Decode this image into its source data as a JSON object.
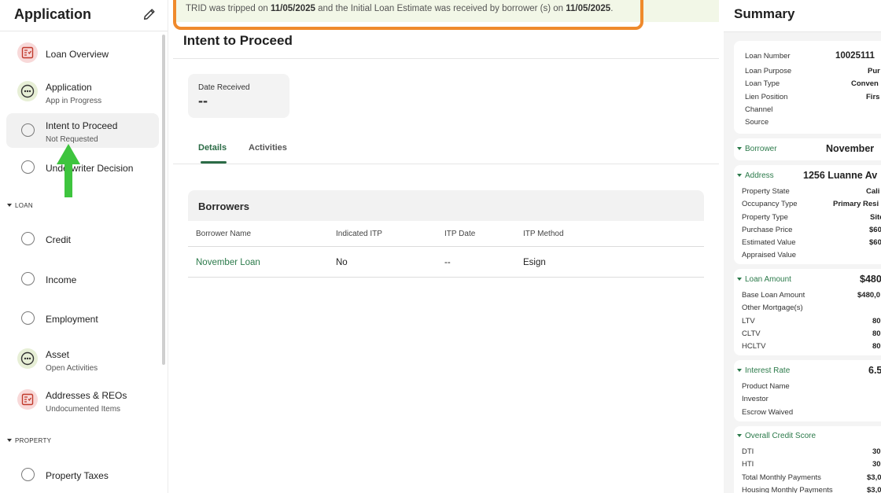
{
  "sidebar": {
    "title": "Application",
    "items": [
      {
        "label": "Loan Overview",
        "sub": "",
        "icon": "document-check-icon"
      },
      {
        "label": "Application",
        "sub": "App in Progress",
        "icon": "in-progress-icon"
      },
      {
        "label": "Intent to Proceed",
        "sub": "Not Requested",
        "icon": "empty-circle-icon"
      },
      {
        "label": "Underwriter Decision",
        "sub": "",
        "icon": "empty-circle-icon"
      }
    ],
    "section_loan": "LOAN",
    "loan_items": [
      {
        "label": "Credit",
        "sub": ""
      },
      {
        "label": "Income",
        "sub": ""
      },
      {
        "label": "Employment",
        "sub": ""
      },
      {
        "label": "Asset",
        "sub": "Open Activities"
      },
      {
        "label": "Addresses & REOs",
        "sub": "Undocumented Items"
      }
    ],
    "section_property": "PROPERTY",
    "property_items": [
      {
        "label": "Property Taxes",
        "sub": ""
      }
    ]
  },
  "banner": {
    "text_1": "TRID was tripped on ",
    "date_1": "11/05/2025",
    "text_2": " and the Initial Loan Estimate was received by borrower (s) on ",
    "date_2": "11/05/2025",
    "text_3": "."
  },
  "main": {
    "title": "Intent to Proceed",
    "date_label": "Date Received",
    "date_value": "--",
    "tabs": [
      "Details",
      "Activities"
    ],
    "borrowers": {
      "title": "Borrowers",
      "columns": [
        "Borrower Name",
        "Indicated ITP",
        "ITP Date",
        "ITP Method"
      ],
      "rows": [
        {
          "name": "November Loan",
          "indicated": "No",
          "date": "--",
          "method": "Esign"
        }
      ]
    }
  },
  "summary": {
    "title": "Summary",
    "loan": [
      {
        "label": "Loan Number",
        "value": "10025111"
      },
      {
        "label": "Loan Purpose",
        "value": "Pur"
      },
      {
        "label": "Loan Type",
        "value": "Conven"
      },
      {
        "label": "Lien Position",
        "value": "Firs"
      },
      {
        "label": "Channel",
        "value": ""
      },
      {
        "label": "Source",
        "value": ""
      }
    ],
    "borrower": {
      "label": "Borrower",
      "value": "November"
    },
    "address": {
      "label": "Address",
      "value": "1256 Luanne Av"
    },
    "address_rows": [
      {
        "label": "Property State",
        "value": "Cali"
      },
      {
        "label": "Occupancy Type",
        "value": "Primary Resi"
      },
      {
        "label": "Property Type",
        "value": "Site"
      },
      {
        "label": "Purchase Price",
        "value": "$60"
      },
      {
        "label": "Estimated Value",
        "value": "$60"
      },
      {
        "label": "Appraised Value",
        "value": ""
      }
    ],
    "loan_amount": {
      "label": "Loan Amount",
      "value": "$480"
    },
    "loan_amount_rows": [
      {
        "label": "Base Loan Amount",
        "value": "$480,0"
      },
      {
        "label": "Other Mortgage(s)",
        "value": ""
      },
      {
        "label": "LTV",
        "value": "80"
      },
      {
        "label": "CLTV",
        "value": "80"
      },
      {
        "label": "HCLTV",
        "value": "80"
      }
    ],
    "interest_rate": {
      "label": "Interest Rate",
      "value": "6.5"
    },
    "interest_rows": [
      {
        "label": "Product Name",
        "value": ""
      },
      {
        "label": "Investor",
        "value": ""
      },
      {
        "label": "Escrow Waived",
        "value": ""
      }
    ],
    "credit_score": {
      "label": "Overall Credit Score",
      "value": ""
    },
    "credit_rows": [
      {
        "label": "DTI",
        "value": "30"
      },
      {
        "label": "HTI",
        "value": "30"
      },
      {
        "label": "Total Monthly Payments",
        "value": "$3,0"
      },
      {
        "label": "Housing Monthly Payments",
        "value": "$3,0"
      }
    ]
  },
  "colors": {
    "accent_green": "#2b6b46",
    "banner_border": "#ef8a2c",
    "banner_bg": "#f2f7e7",
    "arrow": "#3ec43e"
  }
}
